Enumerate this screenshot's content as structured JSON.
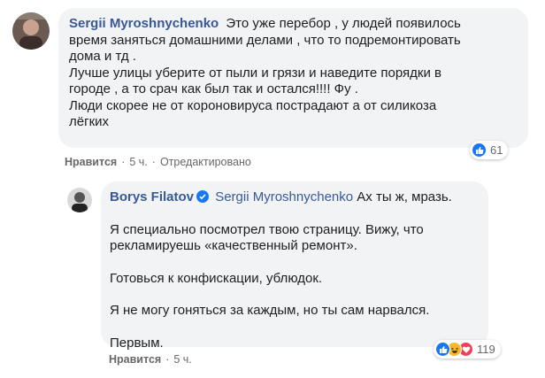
{
  "comment1": {
    "author": "Sergii Myroshnychenko",
    "lines": [
      "Это уже перебор , у людей появилось",
      "время заняться домашними делами , что то подремонтировать",
      "дома и тд .",
      "Лучше улицы уберите от пыли и грязи и наведите порядки в",
      "городе , а то срач как был так и остался!!!! Фу .",
      "Люди скорее не от короновируса пострадают а от силикоза",
      "лёгких"
    ],
    "reaction_count": "61",
    "actions": {
      "like": "Нравится",
      "time": "5 ч.",
      "edited": "Отредактировано"
    }
  },
  "comment2": {
    "author": "Borys Filatov",
    "mention": "Sergii Myroshnychenko",
    "first_line_text": "Ах ты ж, мразь.",
    "paragraphs": [
      [
        "Я специально посмотрел твою страницу. Вижу, что",
        "рекламируешь «качественный ремонт»."
      ],
      [
        "Готовься к конфискации, ублюдок."
      ],
      [
        "Я не могу гоняться за каждым, но ты сам нарвался."
      ],
      [
        "Первым."
      ]
    ],
    "reaction_count": "119",
    "actions": {
      "like": "Нравится",
      "time": "5 ч."
    }
  },
  "colors": {
    "link_blue": "#385898",
    "bubble_bg": "#f2f3f5",
    "like_blue": "#1877f2",
    "heart_red": "#f33e58",
    "haha_yellow": "#f7b928",
    "meta_gray": "#65676b"
  },
  "icons": {
    "comment1_reactions": [
      "like-icon"
    ],
    "comment2_reactions": [
      "like-icon",
      "haha-icon",
      "heart-icon"
    ],
    "verified": "verified-badge-icon"
  }
}
